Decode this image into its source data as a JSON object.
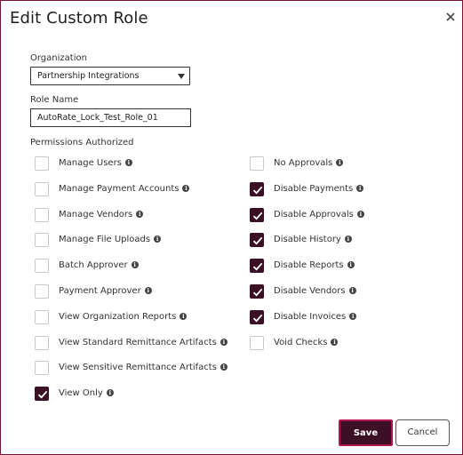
{
  "dialog": {
    "title": "Edit Custom Role",
    "close_icon": "close-icon"
  },
  "organization": {
    "label": "Organization",
    "selected": "Partnership Integrations"
  },
  "role_name": {
    "label": "Role Name",
    "value": "AutoRate_Lock_Test_Role_01"
  },
  "permissions": {
    "label": "Permissions Authorized",
    "left": [
      {
        "label": "Manage Users",
        "checked": false
      },
      {
        "label": "Manage Payment Accounts",
        "checked": false
      },
      {
        "label": "Manage Vendors",
        "checked": false
      },
      {
        "label": "Manage File Uploads",
        "checked": false
      },
      {
        "label": "Batch Approver",
        "checked": false
      },
      {
        "label": "Payment Approver",
        "checked": false
      },
      {
        "label": "View Organization Reports",
        "checked": false
      },
      {
        "label": "View Standard Remittance Artifacts",
        "checked": false
      },
      {
        "label": "View Sensitive Remittance Artifacts",
        "checked": false
      },
      {
        "label": "View Only",
        "checked": true
      }
    ],
    "right": [
      {
        "label": "No Approvals",
        "checked": false
      },
      {
        "label": "Disable Payments",
        "checked": true
      },
      {
        "label": "Disable Approvals",
        "checked": true
      },
      {
        "label": "Disable History",
        "checked": true
      },
      {
        "label": "Disable Reports",
        "checked": true
      },
      {
        "label": "Disable Vendors",
        "checked": true
      },
      {
        "label": "Disable Invoices",
        "checked": true
      },
      {
        "label": "Void Checks",
        "checked": false
      }
    ]
  },
  "buttons": {
    "save": "Save",
    "cancel": "Cancel"
  },
  "colors": {
    "accent": "#3b1024",
    "save_border": "#b1154f",
    "dialog_border": "#7a1535"
  }
}
